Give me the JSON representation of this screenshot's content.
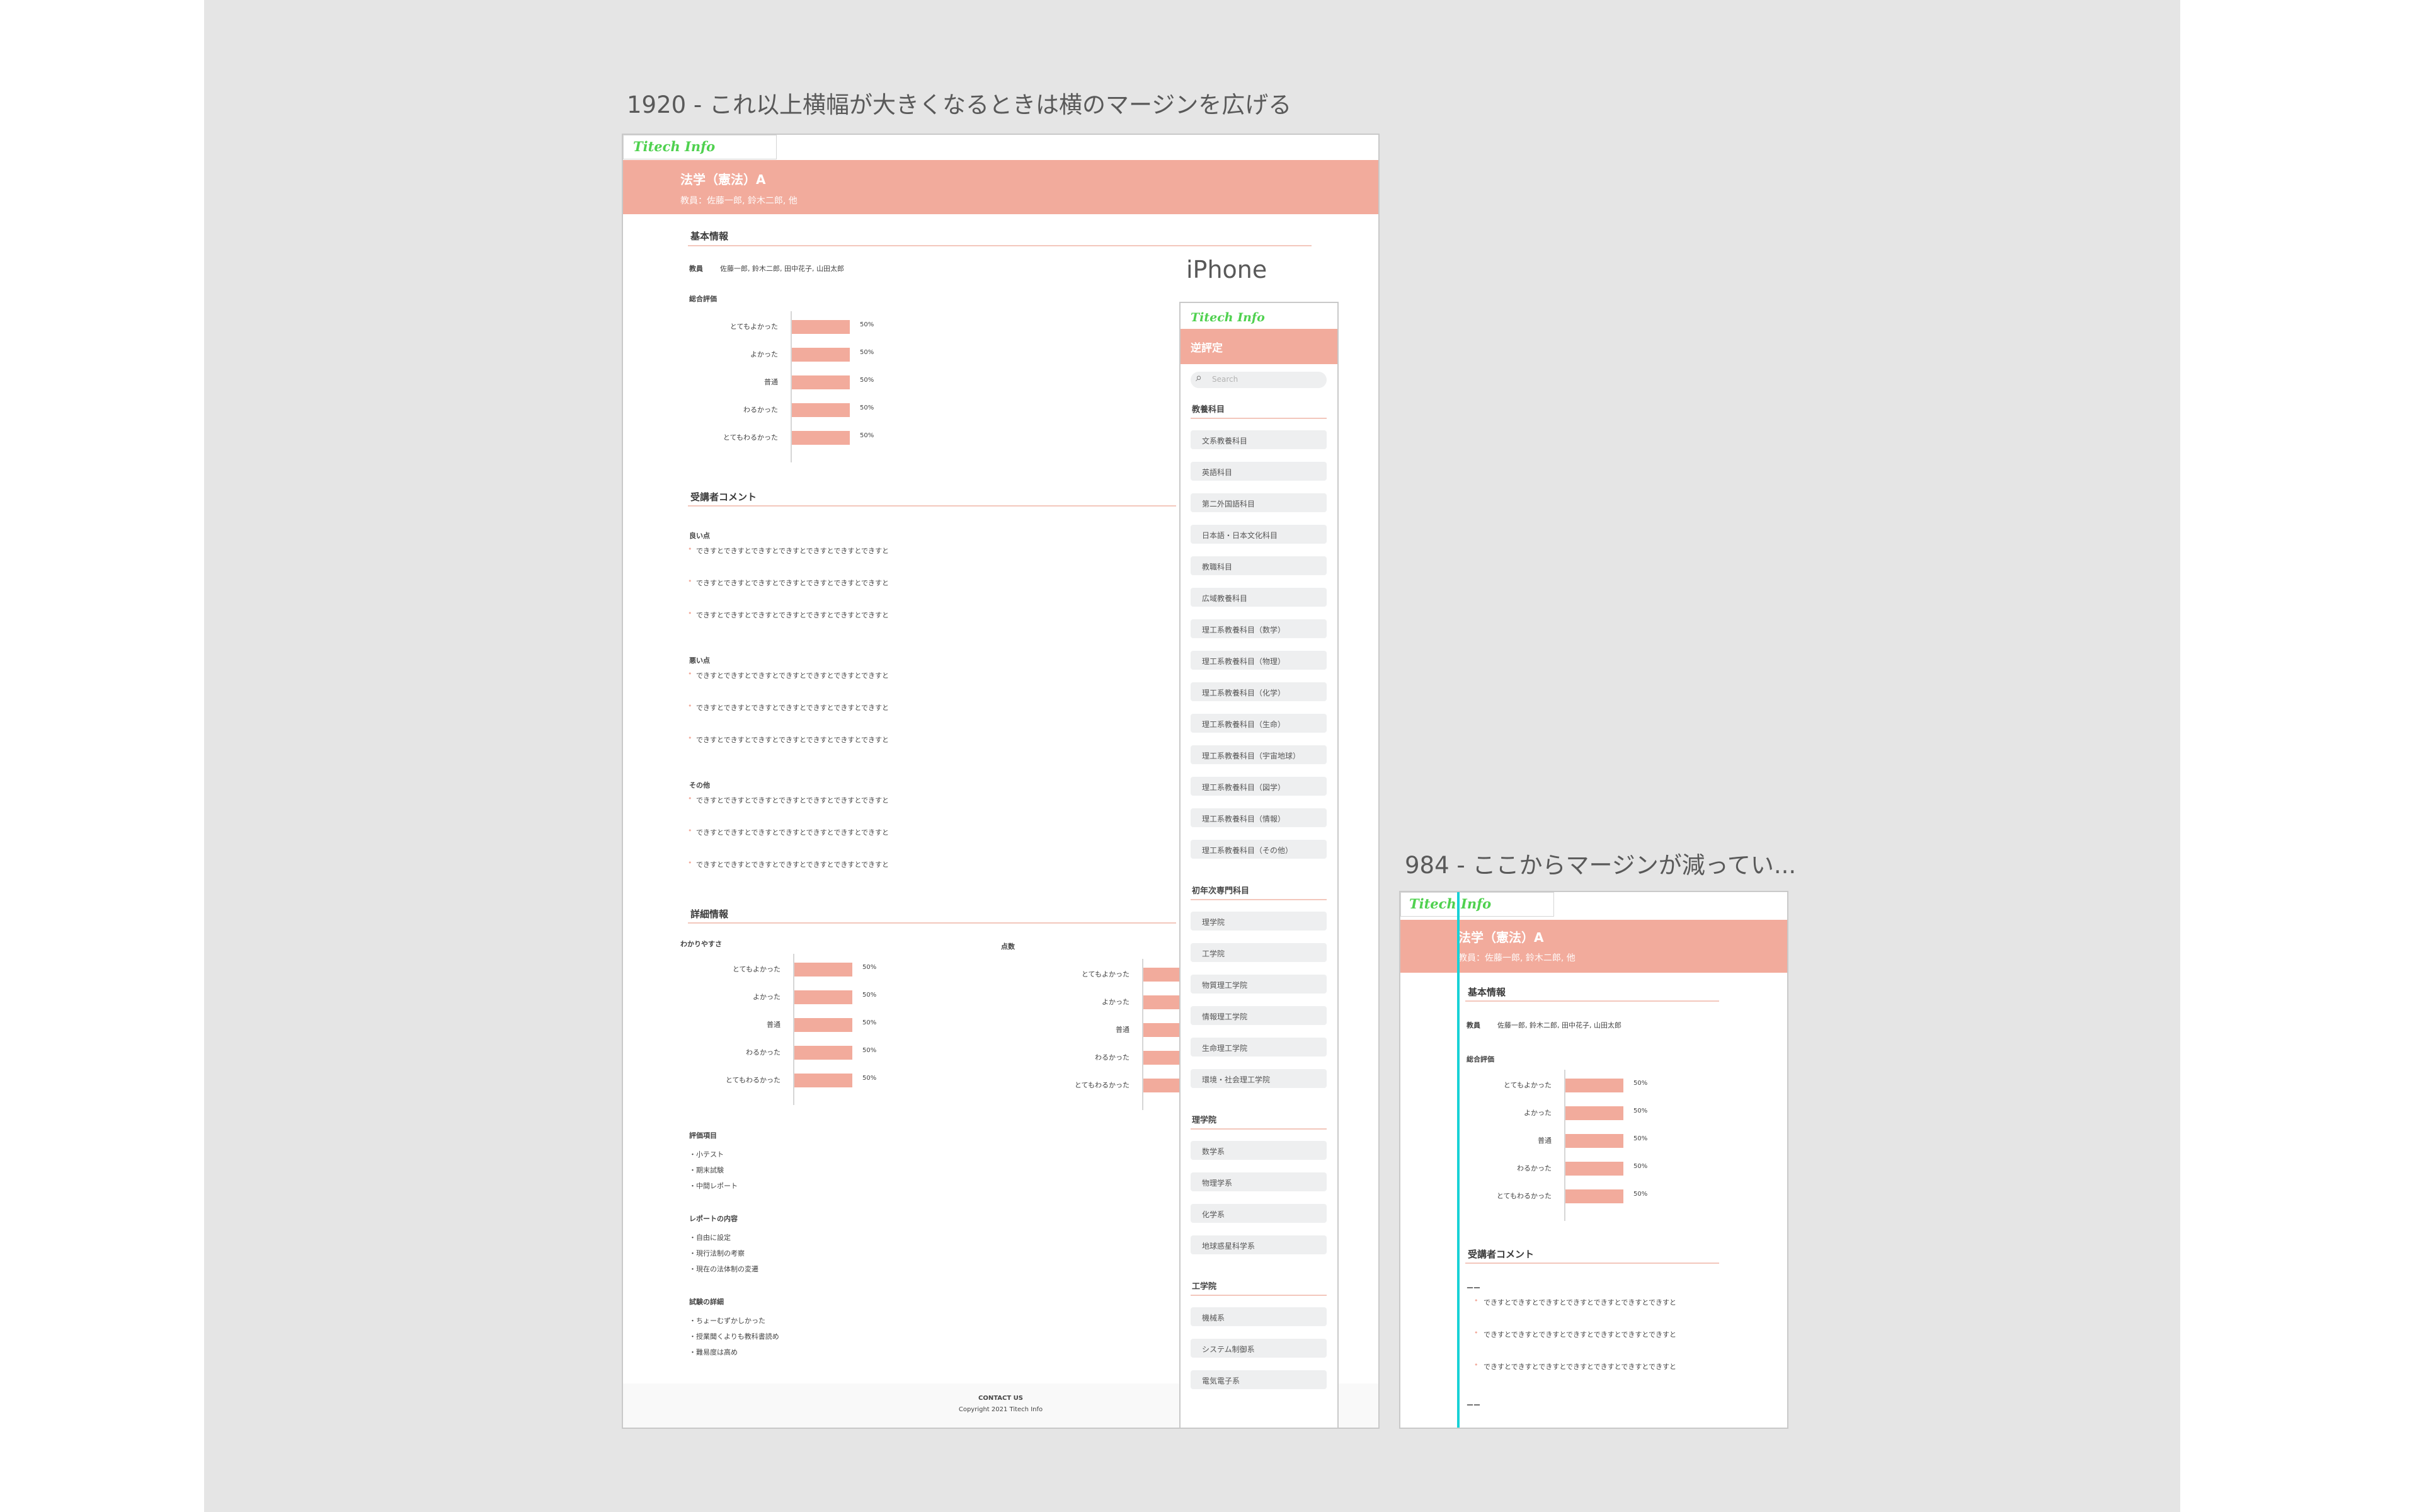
{
  "brand": {
    "logo": "Titech Info",
    "accent": "#f2ab9c",
    "logo_color": "#4fd14f"
  },
  "frames": {
    "desktop_label": "1920 - これ以上横幅が大きくなるときは横のマージンを広げる",
    "iphone_label": "iPhone",
    "tablet_label": "984 - ここからマージンが減ってい..."
  },
  "course": {
    "title": "法学（憲法）A",
    "teachers_line": "教員：佐藤一郎, 鈴木二郎, 他"
  },
  "basic": {
    "heading": "基本情報",
    "teacher_label": "教員",
    "teacher_value": "佐藤一郎, 鈴木二郎, 田中花子, 山田太郎",
    "overall_label": "総合評価"
  },
  "rating_categories": [
    "とてもよかった",
    "よかった",
    "普通",
    "わるかった",
    "とてもわるかった"
  ],
  "overall_values": [
    "50%",
    "50%",
    "50%",
    "50%",
    "50%"
  ],
  "comments": {
    "heading": "受講者コメント",
    "good_label": "良い点",
    "bad_label": "悪い点",
    "other_label": "その他",
    "item": "できすとできすとできすとできすとできすとできすとできすと",
    "tablet_label": "ーー"
  },
  "details": {
    "heading": "詳細情報",
    "clarity_label": "わかりやすさ",
    "grading_label": "点数",
    "clarity_values": [
      "50%",
      "50%",
      "50%",
      "50%",
      "50%"
    ],
    "eval_heading": "評価項目",
    "eval_items": [
      "小テスト",
      "期末試験",
      "中間レポート"
    ],
    "report_heading": "レポートの内容",
    "report_items": [
      "自由に設定",
      "現行法制の考察",
      "現在の法体制の変遷"
    ],
    "exam_heading": "試験の詳細",
    "exam_items": [
      "ちょーむずかしかった",
      "授業聞くよりも教科書読め",
      "難易度は高め"
    ]
  },
  "footer": {
    "contact": "CONTACT US",
    "copyright": "Copyright 2021 Titech Info"
  },
  "iphone": {
    "banner_title": "逆評定",
    "search_placeholder": "Search",
    "groups": [
      {
        "heading": "教養科目",
        "items": [
          "文系教養科目",
          "英語科目",
          "第二外国語科目",
          "日本語・日本文化科目",
          "教職科目",
          "広域教養科目",
          "理工系教養科目（数学）",
          "理工系教養科目（物理）",
          "理工系教養科目（化学）",
          "理工系教養科目（生命）",
          "理工系教養科目（宇宙地球）",
          "理工系教養科目（図学）",
          "理工系教養科目（情報）",
          "理工系教養科目（その他）"
        ]
      },
      {
        "heading": "初年次専門科目",
        "items": [
          "理学院",
          "工学院",
          "物質理工学院",
          "情報理工学院",
          "生命理工学院",
          "環境・社会理工学院"
        ]
      },
      {
        "heading": "理学院",
        "items": [
          "数学系",
          "物理学系",
          "化学系",
          "地球惑星科学系"
        ]
      },
      {
        "heading": "工学院",
        "items": [
          "機械系",
          "システム制御系",
          "電気電子系"
        ]
      }
    ]
  }
}
